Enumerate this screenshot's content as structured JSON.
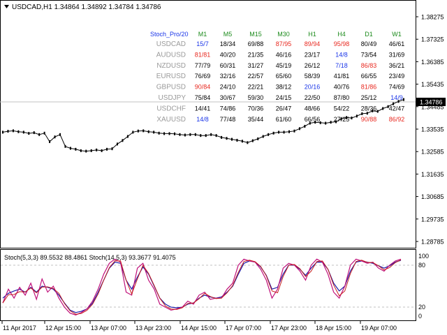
{
  "header": {
    "title": "USDCAD,H1  1.34864 1.34892 1.34784 1.34786",
    "menu_arrow": "triangle-down-icon"
  },
  "price_axis": {
    "labels": [
      "1.38275",
      "1.37325",
      "1.36385",
      "1.35435",
      "1.34485",
      "1.33535",
      "1.32585",
      "1.31635",
      "1.30685",
      "1.29735",
      "1.28785"
    ],
    "current_price": "1.34786"
  },
  "table": {
    "indicator_label": "Stoch_Pro/20",
    "timeframes": [
      "M1",
      "M5",
      "M15",
      "M30",
      "H1",
      "H4",
      "D1",
      "W1"
    ],
    "rows": [
      {
        "symbol": "USDCAD",
        "cells": [
          [
            "15/7",
            "#1a35e8"
          ],
          [
            "18/34",
            "#000000"
          ],
          [
            "69/88",
            "#000000"
          ],
          [
            "87/95",
            "#e8281f"
          ],
          [
            "89/94",
            "#e8281f"
          ],
          [
            "95/98",
            "#e8281f"
          ],
          [
            "80/49",
            "#000000"
          ],
          [
            "46/61",
            "#000000"
          ]
        ]
      },
      {
        "symbol": "AUDUSD",
        "cells": [
          [
            "81/81",
            "#e8281f"
          ],
          [
            "40/20",
            "#000000"
          ],
          [
            "21/35",
            "#000000"
          ],
          [
            "46/16",
            "#000000"
          ],
          [
            "23/17",
            "#000000"
          ],
          [
            "14/8",
            "#1a35e8"
          ],
          [
            "73/54",
            "#000000"
          ],
          [
            "31/69",
            "#000000"
          ]
        ]
      },
      {
        "symbol": "NZDUSD",
        "cells": [
          [
            "77/79",
            "#000000"
          ],
          [
            "60/31",
            "#000000"
          ],
          [
            "31/27",
            "#000000"
          ],
          [
            "45/19",
            "#000000"
          ],
          [
            "26/12",
            "#000000"
          ],
          [
            "7/18",
            "#1a35e8"
          ],
          [
            "86/83",
            "#e8281f"
          ],
          [
            "36/21",
            "#000000"
          ]
        ]
      },
      {
        "symbol": "EURUSD",
        "cells": [
          [
            "76/69",
            "#000000"
          ],
          [
            "32/16",
            "#000000"
          ],
          [
            "22/57",
            "#000000"
          ],
          [
            "65/60",
            "#000000"
          ],
          [
            "58/39",
            "#000000"
          ],
          [
            "41/81",
            "#000000"
          ],
          [
            "66/55",
            "#000000"
          ],
          [
            "23/49",
            "#000000"
          ]
        ]
      },
      {
        "symbol": "GBPUSD",
        "cells": [
          [
            "90/84",
            "#e8281f"
          ],
          [
            "24/10",
            "#000000"
          ],
          [
            "22/21",
            "#000000"
          ],
          [
            "38/12",
            "#000000"
          ],
          [
            "20/16",
            "#1a35e8"
          ],
          [
            "40/76",
            "#000000"
          ],
          [
            "81/86",
            "#e8281f"
          ],
          [
            "74/69",
            "#000000"
          ]
        ]
      },
      {
        "symbol": "USDJPY",
        "cells": [
          [
            "75/84",
            "#000000"
          ],
          [
            "30/67",
            "#000000"
          ],
          [
            "59/30",
            "#000000"
          ],
          [
            "24/15",
            "#000000"
          ],
          [
            "22/50",
            "#000000"
          ],
          [
            "87/80",
            "#000000"
          ],
          [
            "25/12",
            "#000000"
          ],
          [
            "14/9",
            "#1a35e8"
          ]
        ]
      },
      {
        "symbol": "USDCHF",
        "cells": [
          [
            "14/41",
            "#000000"
          ],
          [
            "74/86",
            "#000000"
          ],
          [
            "70/36",
            "#000000"
          ],
          [
            "26/47",
            "#000000"
          ],
          [
            "48/66",
            "#000000"
          ],
          [
            "54/22",
            "#000000"
          ],
          [
            "28/36",
            "#000000"
          ],
          [
            "42/47",
            "#000000"
          ]
        ]
      },
      {
        "symbol": "XAUUSD",
        "cells": [
          [
            "14/8",
            "#1a35e8"
          ],
          [
            "77/48",
            "#000000"
          ],
          [
            "35/44",
            "#000000"
          ],
          [
            "61/60",
            "#000000"
          ],
          [
            "66/56",
            "#000000"
          ],
          [
            "27/25",
            "#000000"
          ],
          [
            "90/88",
            "#e8281f"
          ],
          [
            "86/92",
            "#e8281f"
          ]
        ]
      }
    ]
  },
  "subwindow": {
    "label": "Stoch(5,3,3) 89.5532 88.4861  Stoch(14,5,3) 93.3677 91.4075",
    "levels": [
      "100",
      "80",
      "20",
      "0"
    ]
  },
  "time_axis": {
    "labels": [
      "11 Apr 2017",
      "12 Apr 15:00",
      "13 Apr 07:00",
      "13 Apr 23:00",
      "14 Apr 15:00",
      "17 Apr 07:00",
      "17 Apr 23:00",
      "18 Apr 15:00",
      "19 Apr 07:00"
    ]
  },
  "chart_data": {
    "type": "line",
    "symbol": "USDCAD",
    "timeframe": "H1",
    "ohlc_header": {
      "open": 1.34864,
      "high": 1.34892,
      "low": 1.34784,
      "close": 1.34786
    },
    "y_range": [
      1.28785,
      1.38275
    ],
    "price_series": [
      1.334,
      1.3344,
      1.3346,
      1.3342,
      1.334,
      1.3335,
      1.3338,
      1.333,
      1.3336,
      1.33,
      1.332,
      1.333,
      1.328,
      1.3272,
      1.3268,
      1.3262,
      1.326,
      1.3262,
      1.3265,
      1.3262,
      1.3268,
      1.327,
      1.329,
      1.3305,
      1.3322,
      1.334,
      1.3345,
      1.3346,
      1.3342,
      1.334,
      1.3336,
      1.3334,
      1.3334,
      1.3333,
      1.333,
      1.3328,
      1.333,
      1.333,
      1.3326,
      1.3326,
      1.333,
      1.3326,
      1.3318,
      1.3314,
      1.331,
      1.3306,
      1.3302,
      1.3296,
      1.3304,
      1.3312,
      1.3322,
      1.333,
      1.3336,
      1.334,
      1.334,
      1.3342,
      1.3345,
      1.3355,
      1.3365,
      1.3378,
      1.3382,
      1.338,
      1.3378,
      1.3382,
      1.3384,
      1.3396,
      1.3402,
      1.34,
      1.3408,
      1.3418,
      1.342,
      1.343,
      1.3428,
      1.344,
      1.3448,
      1.346,
      1.347,
      1.3478
    ],
    "stoch_fast": [
      22,
      45,
      30,
      48,
      35,
      55,
      28,
      62,
      40,
      50,
      30,
      15,
      5,
      2,
      6,
      12,
      25,
      45,
      70,
      88,
      95,
      90,
      40,
      35,
      80,
      88,
      60,
      45,
      20,
      15,
      10,
      12,
      15,
      25,
      20,
      35,
      40,
      28,
      30,
      30,
      45,
      55,
      85,
      95,
      92,
      90,
      78,
      60,
      30,
      45,
      80,
      88,
      85,
      75,
      60,
      85,
      95,
      90,
      70,
      40,
      30,
      50,
      85,
      95,
      92,
      88,
      90,
      80,
      75,
      85,
      92,
      95
    ],
    "stoch_slow": [
      30,
      38,
      42,
      45,
      40,
      48,
      40,
      50,
      48,
      45,
      35,
      22,
      10,
      6,
      8,
      12,
      22,
      40,
      60,
      80,
      90,
      88,
      60,
      45,
      65,
      82,
      70,
      50,
      30,
      20,
      15,
      14,
      15,
      20,
      22,
      30,
      35,
      32,
      30,
      32,
      40,
      50,
      70,
      88,
      92,
      90,
      82,
      68,
      45,
      48,
      70,
      85,
      85,
      78,
      68,
      80,
      90,
      90,
      78,
      55,
      42,
      50,
      75,
      90,
      92,
      90,
      88,
      84,
      80,
      84,
      90,
      93
    ]
  }
}
